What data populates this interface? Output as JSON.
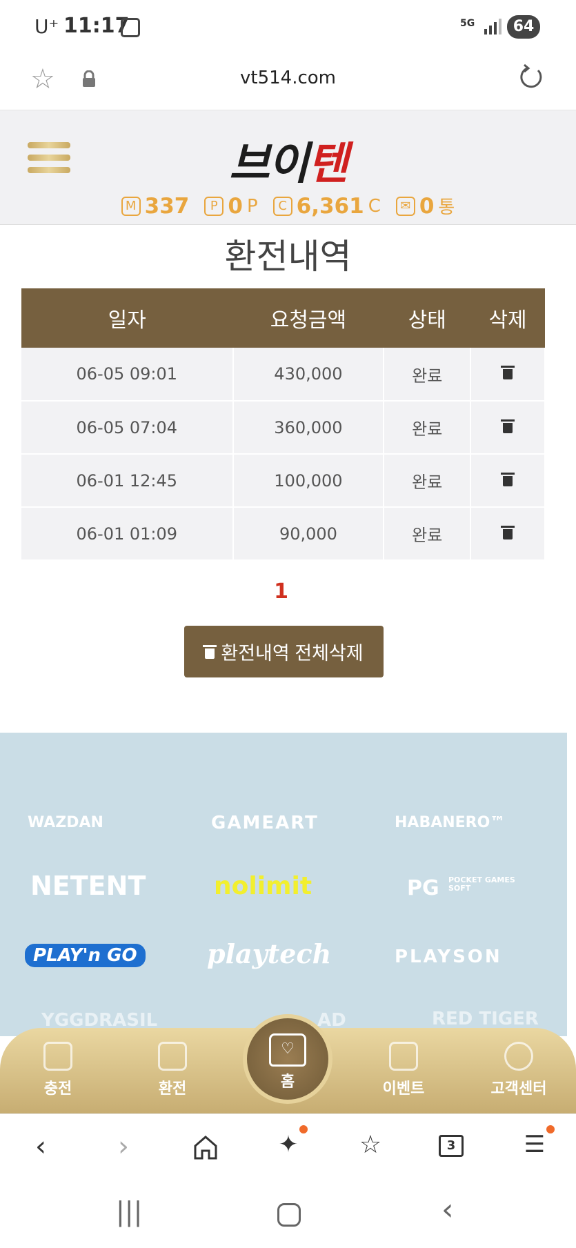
{
  "status_bar": {
    "carrier": "U⁺",
    "time": "11:17",
    "network": "5G",
    "battery": "64"
  },
  "browser": {
    "url": "vt514.com"
  },
  "site": {
    "logo_dark": "브이",
    "logo_red": "텐",
    "stats": [
      {
        "badge": "M",
        "value": "337",
        "unit": ""
      },
      {
        "badge": "P",
        "value": "0",
        "unit": "P"
      },
      {
        "badge": "C",
        "value": "6,361",
        "unit": "C"
      },
      {
        "badge": "✉",
        "value": "0",
        "unit": "통"
      }
    ]
  },
  "page": {
    "title": "환전내역",
    "columns": [
      "일자",
      "요청금액",
      "상태",
      "삭제"
    ],
    "rows": [
      {
        "date": "06-05 09:01",
        "amount": "430,000",
        "status": "완료"
      },
      {
        "date": "06-05 07:04",
        "amount": "360,000",
        "status": "완료"
      },
      {
        "date": "06-01 12:45",
        "amount": "100,000",
        "status": "완료"
      },
      {
        "date": "06-01 01:09",
        "amount": "90,000",
        "status": "완료"
      }
    ],
    "pagination": "1",
    "delete_all_label": "환전내역 전체삭제"
  },
  "providers": {
    "logos": [
      "WAZDAN",
      "GAMEART",
      "HABANERO™",
      "NETENT",
      "nolimit",
      "POCKET GAMES SOFT",
      "PLAY'n GO",
      "playtech",
      "PLAYSON",
      "YGGDRASIL",
      "AD",
      "RED TIGER"
    ],
    "pg_mark": "PG"
  },
  "bottom_nav": {
    "charge": "충전",
    "exchange": "환전",
    "home": "홈",
    "event": "이벤트",
    "support": "고객센터"
  },
  "toolbar": {
    "tabs_count": "3"
  }
}
